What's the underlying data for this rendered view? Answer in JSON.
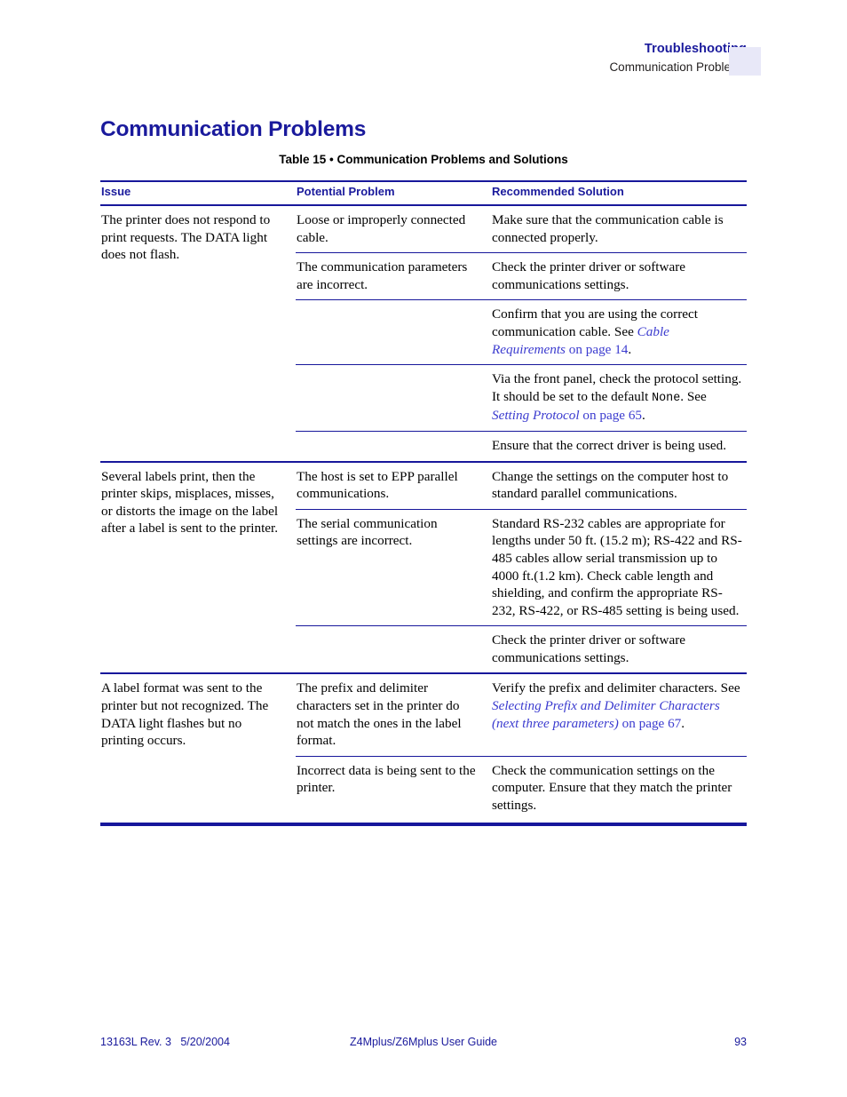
{
  "header": {
    "chapter": "Troubleshooting",
    "section": "Communication Problems",
    "tab_color": "#e8e8f8"
  },
  "title": "Communication Problems",
  "table": {
    "caption": "Table 15 • Communication Problems and Solutions",
    "columns": [
      "Issue",
      "Potential Problem",
      "Recommended Solution"
    ],
    "accent_color": "#17179b",
    "link_color": "#3b3bcf",
    "groups": [
      {
        "issue": "The printer does not respond to print requests. The DATA light does not flash.",
        "rows": [
          {
            "problem": "Loose or improperly connected cable.",
            "solution_parts": [
              {
                "type": "text",
                "text": "Make sure that the communication cable is connected properly."
              }
            ]
          },
          {
            "problem": "The communication parameters are incorrect.",
            "solution_parts": [
              {
                "type": "text",
                "text": "Check the printer driver or software communications settings."
              }
            ]
          },
          {
            "problem": "",
            "solution_parts": [
              {
                "type": "text",
                "text": "Confirm that you are using the correct communication cable. See "
              },
              {
                "type": "xref",
                "text": "Cable Requirements"
              },
              {
                "type": "xref-plain",
                "text": " on page 14"
              },
              {
                "type": "text",
                "text": "."
              }
            ]
          },
          {
            "problem": "",
            "solution_parts": [
              {
                "type": "text",
                "text": "Via the front panel, check the protocol setting. It should be set to the default "
              },
              {
                "type": "mono",
                "text": "None"
              },
              {
                "type": "text",
                "text": ". See "
              },
              {
                "type": "xref",
                "text": "Setting Protocol"
              },
              {
                "type": "xref-plain",
                "text": " on page 65"
              },
              {
                "type": "text",
                "text": "."
              }
            ]
          },
          {
            "problem": "",
            "solution_parts": [
              {
                "type": "text",
                "text": "Ensure that the correct driver is being used."
              }
            ]
          }
        ]
      },
      {
        "issue": "Several labels print, then the printer skips, misplaces, misses, or distorts the image on the label after a label is sent to the printer.",
        "rows": [
          {
            "problem": "The host is set to EPP parallel communications.",
            "solution_parts": [
              {
                "type": "text",
                "text": "Change the settings on the computer host to standard parallel communications."
              }
            ]
          },
          {
            "problem": "The serial communication settings are incorrect.",
            "solution_parts": [
              {
                "type": "text",
                "text": "Standard RS-232 cables are appropriate for lengths under 50 ft. (15.2 m); RS-422 and RS-485 cables allow serial transmission up to 4000 ft.(1.2 km). Check cable length and shielding, and confirm the appropriate RS-232, RS-422, or RS-485 setting is being used."
              }
            ]
          },
          {
            "problem": "",
            "solution_parts": [
              {
                "type": "text",
                "text": "Check the printer driver or software communications settings."
              }
            ]
          }
        ]
      },
      {
        "issue": "A label format was sent to the printer but not recognized. The DATA light flashes but no printing occurs.",
        "rows": [
          {
            "problem": "The prefix and delimiter characters set in the printer do not match the ones in the label format.",
            "solution_parts": [
              {
                "type": "text",
                "text": "Verify the prefix and delimiter characters. See "
              },
              {
                "type": "xref",
                "text": "Selecting Prefix and Delimiter Characters (next three parameters)"
              },
              {
                "type": "xref-plain",
                "text": " on page 67"
              },
              {
                "type": "text",
                "text": "."
              }
            ]
          },
          {
            "problem": "Incorrect data is being sent to the printer.",
            "solution_parts": [
              {
                "type": "text",
                "text": "Check the communication settings on the computer. Ensure that they match the printer settings."
              }
            ]
          }
        ]
      }
    ]
  },
  "footer": {
    "left": "13163L Rev. 3   5/20/2004",
    "center": "Z4Mplus/Z6Mplus User Guide",
    "right": "93"
  }
}
